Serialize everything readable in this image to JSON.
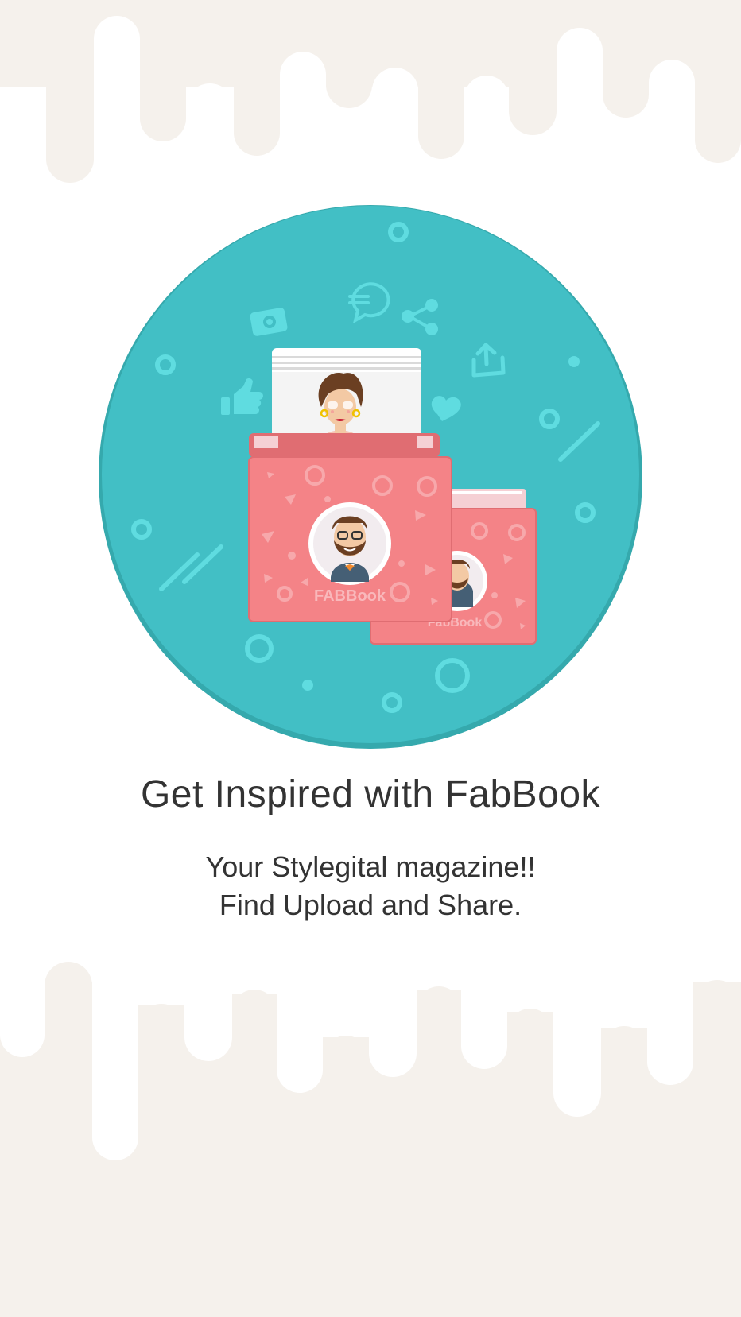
{
  "onboarding": {
    "title": "Get Inspired with FabBook",
    "subtitle_line1": "Your Stylegital magazine!!",
    "subtitle_line2": "Find Upload and Share."
  },
  "illustration": {
    "front_book_brand": "FABBook",
    "back_book_brand": "FabBook"
  },
  "icons": [
    "camera-icon",
    "chat-bubble-icon",
    "share-icon",
    "upload-icon",
    "thumbs-up-icon",
    "heart-icon"
  ],
  "colors": {
    "background": "#ffffff",
    "drip": "#f5f1ec",
    "circle": "#42bfc5",
    "circle_edge": "#35a9ad",
    "decor": "#5fdce0",
    "book": "#f48387",
    "book_edge": "#e06d72",
    "text": "#333333"
  }
}
